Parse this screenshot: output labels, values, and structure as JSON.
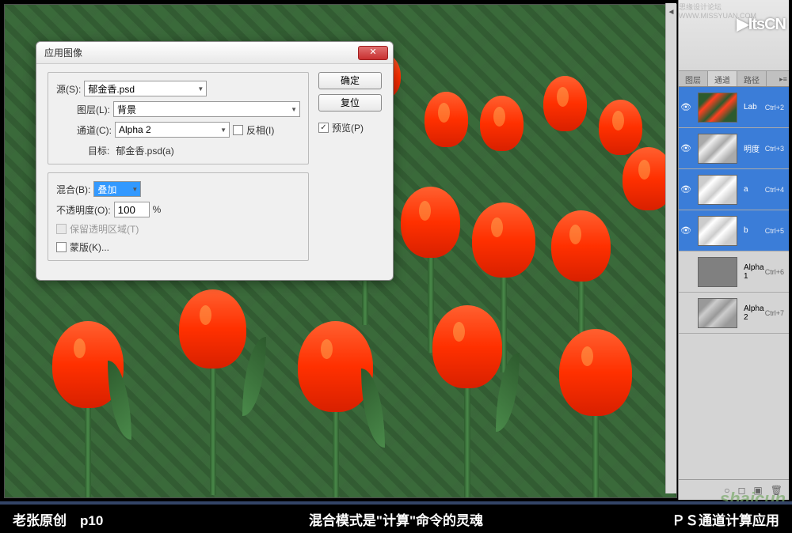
{
  "dialog": {
    "title": "应用图像",
    "source_label": "源(S):",
    "source_value": "郁金香.psd",
    "layer_label": "图层(L):",
    "layer_value": "背景",
    "channel_label": "通道(C):",
    "channel_value": "Alpha 2",
    "invert_label": "反相(I)",
    "target_label": "目标:",
    "target_value": "郁金香.psd(a)",
    "blend_label": "混合(B):",
    "blend_value": "叠加",
    "opacity_label": "不透明度(O):",
    "opacity_value": "100",
    "opacity_pct": "%",
    "preserve_label": "保留透明区域(T)",
    "mask_label": "蒙版(K)...",
    "ok": "确定",
    "reset": "复位",
    "preview": "预览(P)"
  },
  "panel": {
    "tabs": [
      "图层",
      "通道",
      "路径"
    ],
    "active_tab": 1
  },
  "channels": [
    {
      "name": "Lab",
      "shortcut": "Ctrl+2",
      "thumb": "color",
      "selected": true,
      "visible": true
    },
    {
      "name": "明度",
      "shortcut": "Ctrl+3",
      "thumb": "gray",
      "selected": true,
      "visible": true
    },
    {
      "name": "a",
      "shortcut": "Ctrl+4",
      "thumb": "light",
      "selected": true,
      "visible": true
    },
    {
      "name": "b",
      "shortcut": "Ctrl+5",
      "thumb": "light",
      "selected": true,
      "visible": true
    },
    {
      "name": "Alpha 1",
      "shortcut": "Ctrl+6",
      "thumb": "solid",
      "selected": false,
      "visible": false
    },
    {
      "name": "Alpha 2",
      "shortcut": "Ctrl+7",
      "thumb": "alpha2",
      "selected": false,
      "visible": false
    }
  ],
  "watermarks": {
    "top_text": "思缘设计论坛  WWW.MISSYUAN.COM",
    "logo": "ItsCN",
    "bottom_right": "shaicun"
  },
  "caption": {
    "left": "老张原创　p10",
    "center": "混合模式是\"计算\"命令的灵魂",
    "right": "ＰＳ通道计算应用"
  }
}
